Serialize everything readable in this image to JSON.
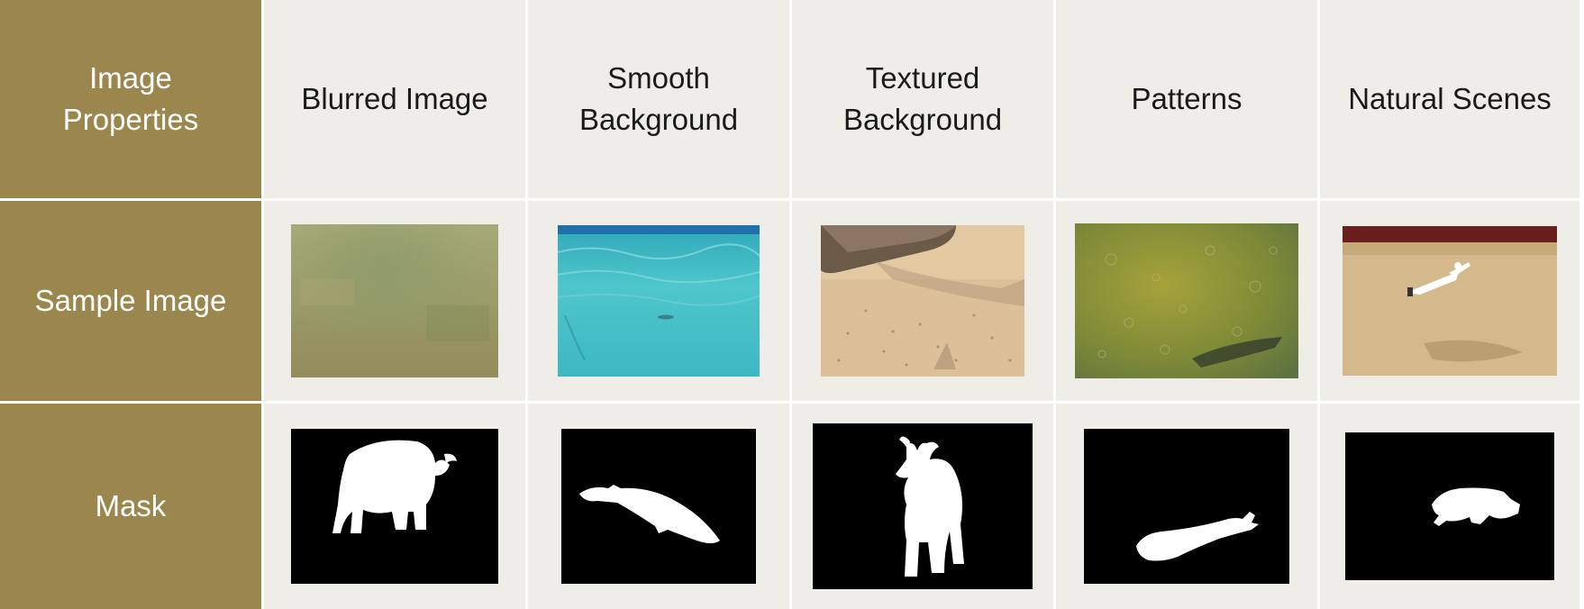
{
  "row_headers": {
    "properties": "Image\nProperties",
    "sample": "Sample Image",
    "mask": "Mask"
  },
  "columns": [
    {
      "label": "Blurred Image",
      "sample_icon": "grass-field-image",
      "mask_icon": "buffalo-mask"
    },
    {
      "label": "Smooth\nBackground",
      "sample_icon": "pool-water-image",
      "mask_icon": "whale-mask"
    },
    {
      "label": "Textured\nBackground",
      "sample_icon": "sand-log-image",
      "mask_icon": "goat-mask"
    },
    {
      "label": "Patterns",
      "sample_icon": "green-water-fish-image",
      "mask_icon": "fish-mask"
    },
    {
      "label": "Natural Scenes",
      "sample_icon": "sand-arena-diver-image",
      "mask_icon": "dog-mask"
    }
  ],
  "colors": {
    "header_bg": "#9b874e",
    "cell_bg": "#efede8",
    "mask_bg": "#000000",
    "mask_fg": "#ffffff"
  }
}
